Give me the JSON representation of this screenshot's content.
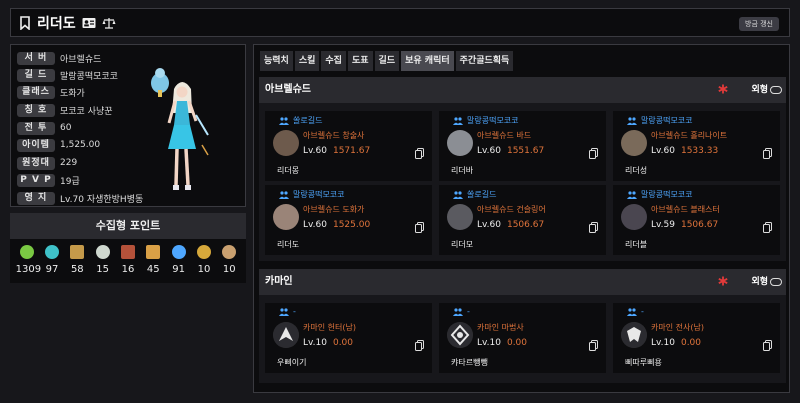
{
  "header": {
    "name": "리더도",
    "refresh_label": "방금 갱신"
  },
  "profile": {
    "rows": [
      {
        "label": "서 버",
        "value": "아브렐슈드"
      },
      {
        "label": "길 드",
        "value": "말랑콩떡모코코"
      },
      {
        "label": "클래스",
        "value": "도화가"
      },
      {
        "label": "칭 호",
        "value": "모코코 사냥꾼"
      },
      {
        "label": "전 투",
        "value": "60"
      },
      {
        "label": "아이템",
        "value": "1,525.00"
      },
      {
        "label": "원정대",
        "value": "229"
      },
      {
        "label": "P V P",
        "value": "19급"
      },
      {
        "label": "영 지",
        "value": "Lv.70 자생한방H병동"
      }
    ]
  },
  "collect": {
    "title": "수집형 포인트",
    "items": [
      {
        "icon": "seed-icon",
        "count": "1309",
        "color": "#7ac943"
      },
      {
        "icon": "island-heart-icon",
        "count": "97",
        "color": "#3fc2c9"
      },
      {
        "icon": "map-icon",
        "count": "58",
        "color": "#c59a4a"
      },
      {
        "icon": "mokoko-icon",
        "count": "15",
        "color": "#cfd8cf"
      },
      {
        "icon": "art-icon",
        "count": "16",
        "color": "#b5523a"
      },
      {
        "icon": "voyage-icon",
        "count": "45",
        "color": "#d9a046"
      },
      {
        "icon": "star-icon",
        "count": "91",
        "color": "#4ea7ff"
      },
      {
        "icon": "world-tree-icon",
        "count": "10",
        "color": "#d6a83b"
      },
      {
        "icon": "orpheus-icon",
        "count": "10",
        "color": "#c9a070"
      }
    ]
  },
  "tabs": [
    {
      "label": "능력치",
      "active": false
    },
    {
      "label": "스킬",
      "active": false
    },
    {
      "label": "수집",
      "active": false
    },
    {
      "label": "도표",
      "active": false
    },
    {
      "label": "길드",
      "active": false
    },
    {
      "label": "보유 캐릭터",
      "active": true
    },
    {
      "label": "주간골드획득",
      "active": false
    }
  ],
  "sections": [
    {
      "server": "아브렐슈드",
      "external_label": "외형",
      "cards": [
        {
          "guild": "쏠로길드",
          "server_class": "아브렐슈드 창술사",
          "level": "Lv.60",
          "item_level": "1571.67",
          "name": "리더몽",
          "avatar": "#6d5a4c"
        },
        {
          "guild": "말랑콩떡모코코",
          "server_class": "아브렐슈드 바드",
          "level": "Lv.60",
          "item_level": "1551.67",
          "name": "리더바",
          "avatar": "#8b8e94"
        },
        {
          "guild": "말랑콩떡모코코",
          "server_class": "아브렐슈드 홀리나이트",
          "level": "Lv.60",
          "item_level": "1533.33",
          "name": "리더성",
          "avatar": "#7a6a5a"
        },
        {
          "guild": "말랑콩떡모코코",
          "server_class": "아브렐슈드 도화가",
          "level": "Lv.60",
          "item_level": "1525.00",
          "name": "리더도",
          "avatar": "#9a8478"
        },
        {
          "guild": "쏠로길드",
          "server_class": "아브렐슈드 건슬링어",
          "level": "Lv.60",
          "item_level": "1506.67",
          "name": "리더모",
          "avatar": "#5a5a60"
        },
        {
          "guild": "말랑콩떡모코코",
          "server_class": "아브렐슈드 블래스터",
          "level": "Lv.59",
          "item_level": "1506.67",
          "name": "리더블",
          "avatar": "#4a4650"
        }
      ]
    },
    {
      "server": "카마인",
      "external_label": "외형",
      "cards": [
        {
          "guild": "-",
          "server_class": "카마인 헌터(남)",
          "level": "Lv.10",
          "item_level": "0.00",
          "name": "우삐이기",
          "avatar": "#2b2b30"
        },
        {
          "guild": "-",
          "server_class": "카마인 마법사",
          "level": "Lv.10",
          "item_level": "0.00",
          "name": "캬타르뺑뺑",
          "avatar": "#2b2b30"
        },
        {
          "guild": "-",
          "server_class": "카마인 전사(남)",
          "level": "Lv.10",
          "item_level": "0.00",
          "name": "삐따루삐용",
          "avatar": "#2b2b30"
        }
      ]
    }
  ],
  "colors": {
    "accent_orange": "#e0743b",
    "guild_blue": "#4ea7ff",
    "star_red": "#e23a3a"
  }
}
